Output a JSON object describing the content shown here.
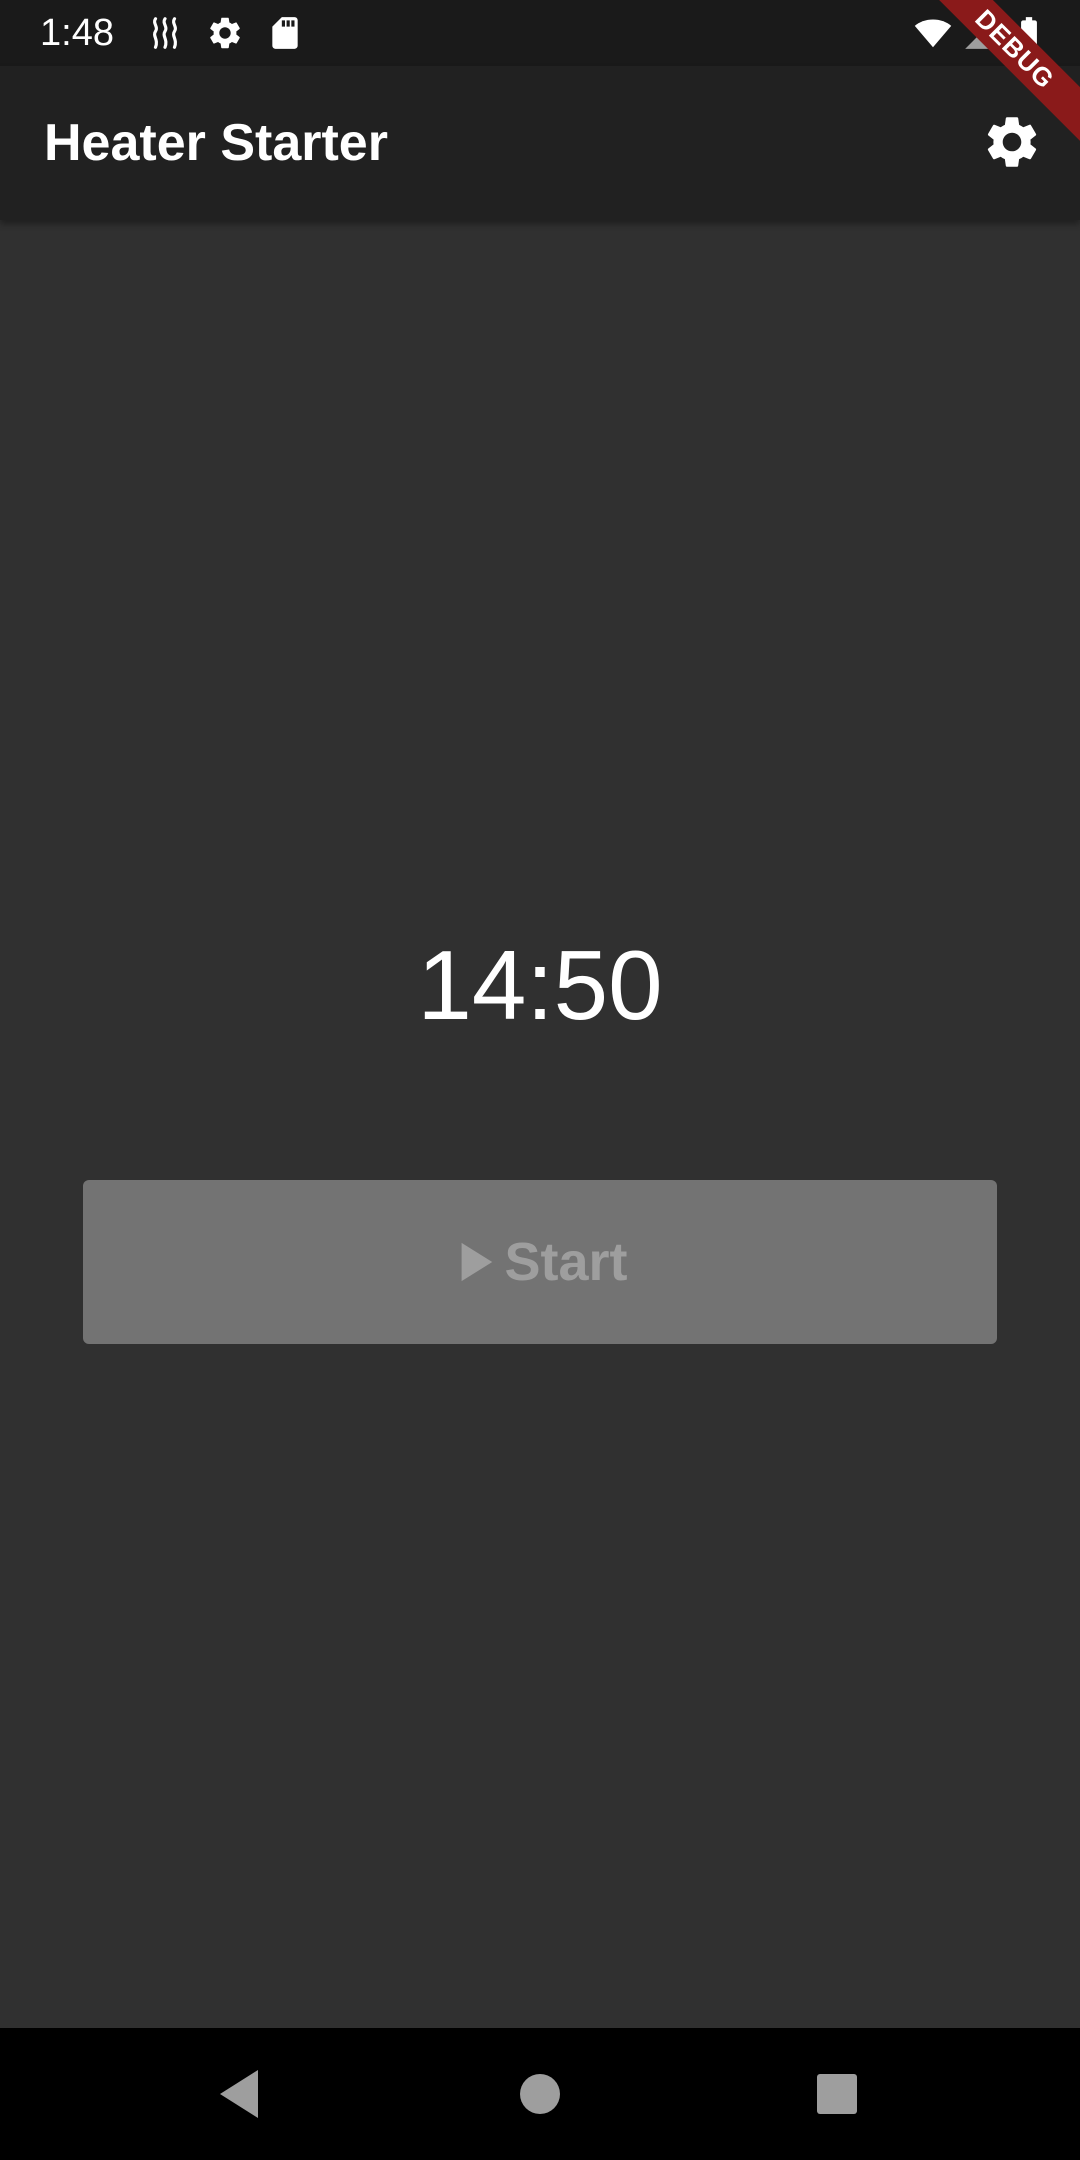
{
  "status_bar": {
    "time": "1:48",
    "icons": [
      "heat-icon",
      "gear-icon",
      "sd-card-icon",
      "wifi-icon",
      "signal-icon",
      "battery-icon"
    ]
  },
  "app_bar": {
    "title": "Heater Starter",
    "action_icon": "gear-icon"
  },
  "debug_banner": {
    "label": "DEBUG",
    "color": "#8a1a1a"
  },
  "main": {
    "timer": "14:50",
    "start_button": {
      "label": "Start",
      "icon": "play-icon",
      "enabled": false
    }
  },
  "nav_bar": {
    "buttons": [
      "back-icon",
      "home-icon",
      "recents-icon"
    ]
  },
  "colors": {
    "background": "#303030",
    "app_bar": "#212121",
    "status_bar": "#1a1a1a",
    "button_disabled": "#737373",
    "button_text_disabled": "#9e9e9e"
  }
}
